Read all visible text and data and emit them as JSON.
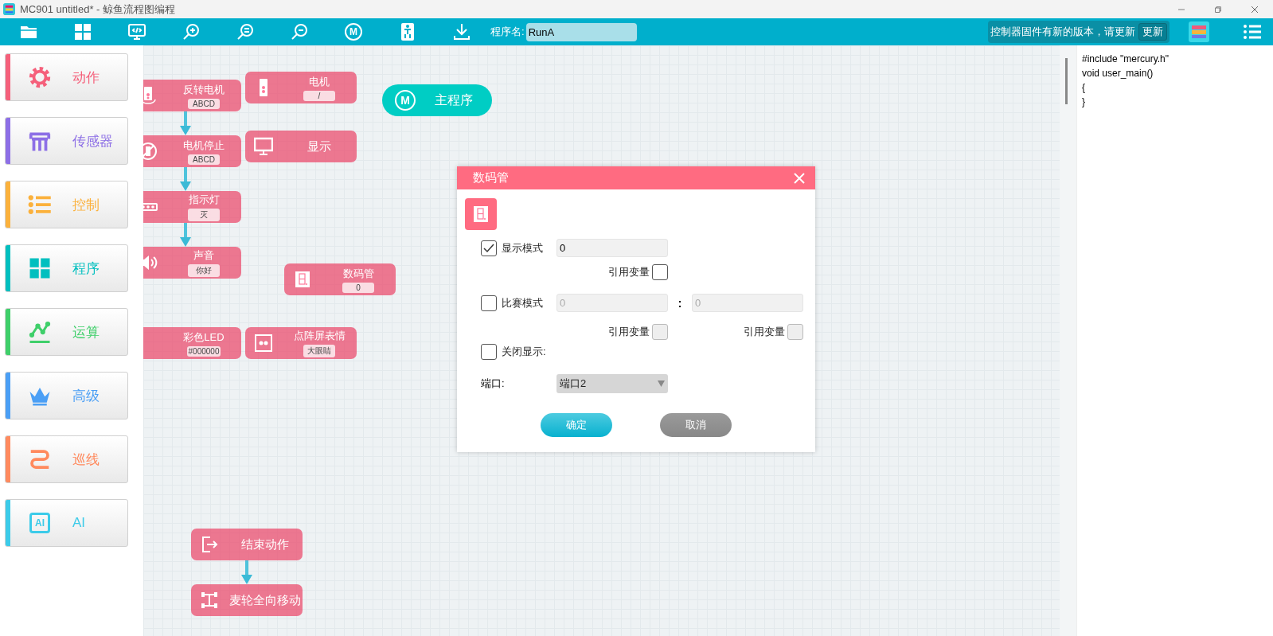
{
  "window": {
    "title": "MC901 untitled* - 鲸鱼流程图编程"
  },
  "toolbar": {
    "tools": [
      {
        "kind": "folder"
      },
      {
        "kind": "grid"
      },
      {
        "kind": "code"
      },
      {
        "kind": "zoom-in"
      },
      {
        "kind": "zoom-reset"
      },
      {
        "kind": "zoom-out"
      },
      {
        "kind": "letter",
        "glyph": "M"
      },
      {
        "kind": "robot"
      },
      {
        "kind": "download"
      }
    ],
    "program_name": {
      "label": "程序名:",
      "value": "RunA"
    },
    "firmware_notice": {
      "text": "控制器固件有新的版本，请更新",
      "button": "更新"
    }
  },
  "sidebar": {
    "items": [
      {
        "label": "动作",
        "color": "#f5607b",
        "kind": "gear"
      },
      {
        "label": "传感器",
        "color": "#8d6fe6",
        "kind": "bench"
      },
      {
        "label": "控制",
        "color": "#fbb13c",
        "kind": "list"
      },
      {
        "label": "程序",
        "color": "#00bfbf",
        "kind": "grid"
      },
      {
        "label": "运算",
        "color": "#3fcf6a",
        "kind": "nodes"
      },
      {
        "label": "高级",
        "color": "#4b9ff5",
        "kind": "crown"
      },
      {
        "label": "巡线",
        "color": "#ff8a5e",
        "kind": "curve"
      },
      {
        "label": "AI",
        "color": "#3ccbe9",
        "kind": "ai",
        "glyph": "AI"
      }
    ]
  },
  "canvas": {
    "main_program": {
      "glyph": "M",
      "label": "主程序"
    },
    "blocks": [
      {
        "kind": "motor-reverse",
        "title": "反转电机",
        "value": "ABCD",
        "arrow_below": true
      },
      {
        "kind": "motor",
        "title": "电机",
        "value": "/",
        "arrow_below": false
      },
      {
        "kind": "motor-stop",
        "title": "电机停止",
        "value": "ABCD",
        "arrow_below": true
      },
      {
        "kind": "monitor",
        "title": "显示",
        "arrow_below": false
      },
      {
        "kind": "led",
        "title": "指示灯",
        "value": "灭",
        "arrow_below": true
      },
      {
        "kind": "speaker",
        "title": "声音",
        "value": "你好",
        "arrow_below": false
      },
      {
        "kind": "digit",
        "title": "数码管",
        "value": "0",
        "arrow_below": false
      },
      {
        "kind": "none",
        "title": "彩色LED",
        "value": "#000000",
        "arrow_below": false
      },
      {
        "kind": "matrix",
        "title": "点阵屏表情",
        "value": "大眼睛",
        "arrow_below": false
      },
      {
        "kind": "exit",
        "title": "结束动作",
        "arrow_below": true
      },
      {
        "kind": "wheels",
        "title": "麦轮全向移动",
        "arrow_below": false
      }
    ]
  },
  "code_panel": {
    "lines": [
      "#include \"mercury.h\"",
      "void user_main()",
      "{",
      "}"
    ]
  },
  "dialog": {
    "title": "数码管",
    "display_mode": {
      "label": "显示模式",
      "checked": true,
      "value": "0",
      "variable": {
        "label": "引用变量",
        "checked": false,
        "disabled": false
      }
    },
    "match_mode": {
      "label": "比赛模式",
      "checked": false,
      "separator": ":",
      "left": {
        "value": "0",
        "disabled": true
      },
      "right": {
        "value": "0",
        "disabled": true
      },
      "left_variable": {
        "label": "引用变量",
        "checked": false,
        "disabled": true
      },
      "right_variable": {
        "label": "引用变量",
        "checked": false,
        "disabled": true
      }
    },
    "close_display": {
      "label": "关闭显示:",
      "checked": false
    },
    "port": {
      "label": "端口:",
      "value": "端口2"
    },
    "buttons": [
      {
        "kind": "confirm",
        "label": "确定"
      },
      {
        "kind": "cancel",
        "label": "取消"
      }
    ]
  }
}
